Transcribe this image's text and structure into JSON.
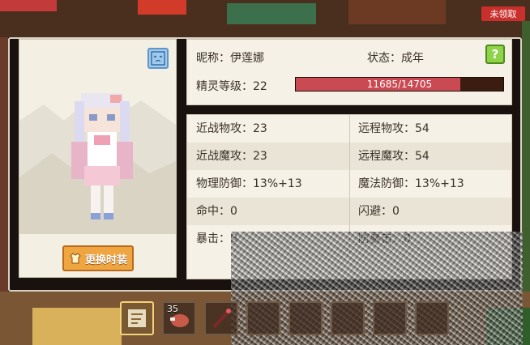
{
  "top_badge": "未领取",
  "nickname_label": "昵称：伊莲娜",
  "status_label": "状态：成年",
  "level_label": "精灵等级：22",
  "xp": {
    "current": 11685,
    "max": 14705,
    "text": "11685/14705",
    "fraction": 0.7946
  },
  "help_label": "?",
  "change_outfit_label": "更换时装",
  "stats": [
    {
      "left": "近战物攻：23",
      "right": "远程物攻：54"
    },
    {
      "left": "近战魔攻：23",
      "right": "远程魔攻：54"
    },
    {
      "left": "物理防御：13%+13",
      "right": "魔法防御：13%+13"
    },
    {
      "left": "命中：0",
      "right": "闪避：0"
    },
    {
      "left": "暴击：0",
      "right": "防暴击：0"
    }
  ],
  "hotbar": [
    {
      "icon": "map-scroll-icon",
      "count": ""
    },
    {
      "icon": "raw-meat-icon",
      "count": "35"
    },
    {
      "icon": "wand-icon",
      "count": ""
    },
    {
      "icon": "item-slot-icon",
      "count": ""
    },
    {
      "icon": "item-slot-icon",
      "count": ""
    },
    {
      "icon": "item-slot-icon",
      "count": ""
    },
    {
      "icon": "item-slot-icon",
      "count": ""
    },
    {
      "icon": "item-slot-icon",
      "count": ""
    }
  ],
  "colors": {
    "xp_fill": "#c94a52",
    "change_button": "#f0a640",
    "help_button": "#8fd34a",
    "mood_button": "#9fcbf0"
  }
}
